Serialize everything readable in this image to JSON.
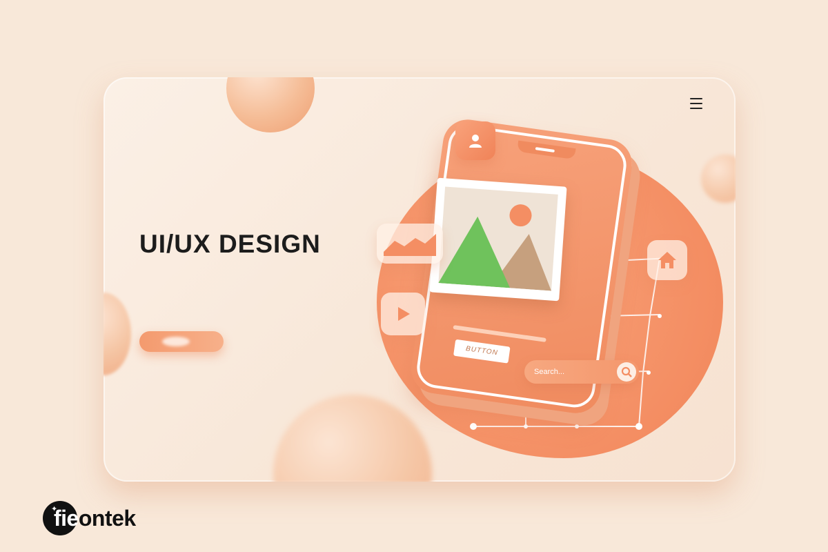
{
  "hero": {
    "title": "UI/UX DESIGN"
  },
  "mockup": {
    "button_label": "BUTTON",
    "search_placeholder": "Search..."
  },
  "brand": {
    "logo_text_light": "fie",
    "logo_text_dark": "ontek"
  },
  "colors": {
    "background": "#f8e8d9",
    "accent": "#f48e63",
    "text": "#1c1c1c"
  },
  "icons": [
    "menu-icon",
    "user-icon",
    "image-icon",
    "chart-icon",
    "play-icon",
    "home-icon",
    "search-icon",
    "sparkle-icon"
  ]
}
